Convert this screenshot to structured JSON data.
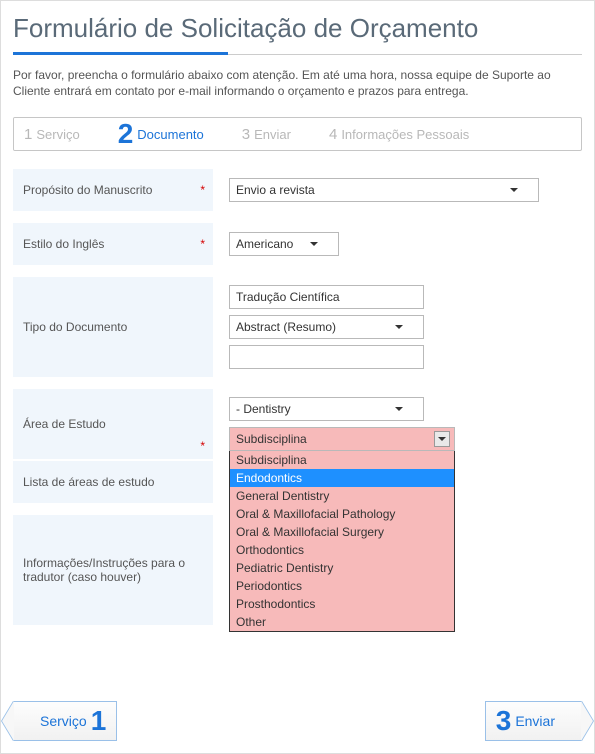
{
  "title": "Formulário de Solicitação de Orçamento",
  "intro": "Por favor, preencha o formulário abaixo com atenção. Em até uma hora, nossa equipe de Suporte ao Cliente entrará em contato por e-mail informando o orçamento e prazos para entrega.",
  "steps": [
    {
      "num": "1",
      "label": "Serviço"
    },
    {
      "num": "2",
      "label": "Documento"
    },
    {
      "num": "3",
      "label": "Enviar"
    },
    {
      "num": "4",
      "label": "Informações Pessoais"
    }
  ],
  "form": {
    "purpose": {
      "label": "Propósito do Manuscrito",
      "value": "Envio a revista"
    },
    "engstyle": {
      "label": "Estilo do Inglês",
      "value": "Americano"
    },
    "doctype": {
      "label": "Tipo do Documento",
      "text_value": "Tradução Científica",
      "select_value": "Abstract (Resumo)",
      "extra_value": ""
    },
    "study": {
      "label": "Área de Estudo",
      "value": "- Dentistry"
    },
    "sublist": {
      "label": "Lista de áreas de estudo",
      "value": ""
    },
    "subdisc": {
      "selected": "Subdisciplina",
      "options": [
        "Subdisciplina",
        "Endodontics",
        "General Dentistry",
        "Oral & Maxillofacial Pathology",
        "Oral & Maxillofacial Surgery",
        "Orthodontics",
        "Pediatric Dentistry",
        "Periodontics",
        "Prosthodontics",
        "Other"
      ],
      "highlight_index": 1
    },
    "notes": {
      "label": "Informações/Instruções para o tradutor (caso houver)",
      "value": ""
    }
  },
  "nav": {
    "prev": {
      "num": "1",
      "label": "Serviço"
    },
    "next": {
      "num": "3",
      "label": "Enviar"
    }
  }
}
